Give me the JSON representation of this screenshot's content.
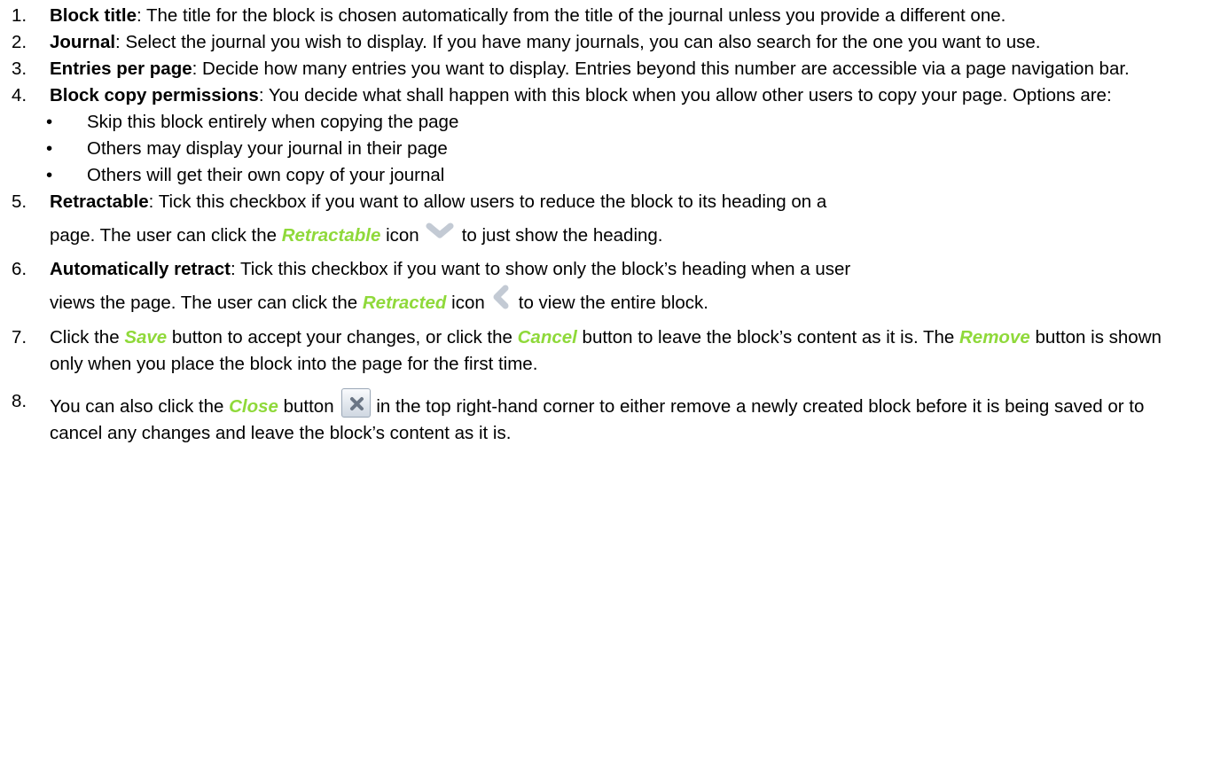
{
  "items": [
    {
      "num": "1.",
      "term": "Block title",
      "text": ": The title for the block is chosen automatically from the title of the journal unless you provide a different one."
    },
    {
      "num": "2.",
      "term": "Journal",
      "text": ": Select the journal you wish to display. If you have many journals, you can also search for the one you want to use."
    },
    {
      "num": "3.",
      "term": "Entries per page",
      "text": ": Decide how many entries you want to display. Entries beyond this number are accessible via a page navigation bar."
    },
    {
      "num": "4.",
      "term": "Block copy permissions",
      "text": ": You decide what shall happen with this block when you allow other users to copy your page. Options are:",
      "options": [
        "Skip this block entirely when copying the page",
        "Others may display your journal in their page",
        "Others will get their own copy of your journal"
      ]
    },
    {
      "num": "5.",
      "term": "Retractable",
      "text1": ": Tick this checkbox if you want to allow users to reduce the block to its heading on a",
      "text2": "page. The user can click the ",
      "hl": "Retractable",
      "text3": " icon",
      "text4": "to just show the heading.",
      "icon": "chevron-down-icon"
    },
    {
      "num": "6.",
      "term": "Automatically retract",
      "text1": ": Tick this checkbox if you want to show only the block’s heading when a user",
      "text2": "views the page. The user can click the ",
      "hl": "Retracted",
      "text3": " icon",
      "text4": "to view the entire block.",
      "icon": "chevron-left-icon"
    },
    {
      "num": "7.",
      "text1": "Click the ",
      "hl1": "Save",
      "text2": " button to accept your changes, or click the ",
      "hl2": "Cancel",
      "text3": " button to leave the block’s content as it is. The ",
      "hl3": "Remove",
      "text4": " button is shown only when you place the block into the page for the first time."
    },
    {
      "num": "8.",
      "text1": "You can also click the ",
      "hl": "Close",
      "text2": " button",
      "text3": "in the top right-hand corner to either remove a newly created block before it is being saved or to cancel any changes and leave the block’s content as it is.",
      "icon": "close-icon"
    }
  ],
  "bullet": "•",
  "colors": {
    "highlight": "#8fd93a",
    "icon": "#c3cad4",
    "close_x": "#6b7685"
  }
}
